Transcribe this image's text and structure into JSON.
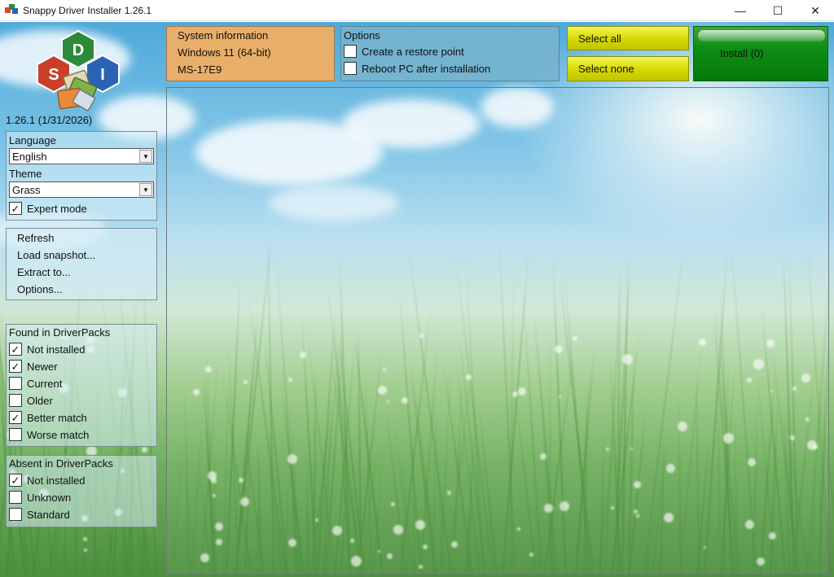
{
  "window": {
    "title": "Snappy Driver Installer 1.26.1",
    "minimize_glyph": "—",
    "maximize_glyph": "☐",
    "close_glyph": "✕"
  },
  "logo": {
    "letters": [
      "D",
      "S",
      "I"
    ]
  },
  "version": "1.26.1 (1/31/2026)",
  "settings": {
    "language_label": "Language",
    "language_value": "English",
    "theme_label": "Theme",
    "theme_value": "Grass",
    "expert_mode_label": "Expert mode",
    "expert_mode_checked": "✓"
  },
  "menu": {
    "refresh": "Refresh",
    "load_snapshot": "Load snapshot...",
    "extract_to": "Extract to...",
    "options": "Options..."
  },
  "found": {
    "title": "Found in DriverPacks",
    "items": [
      {
        "label": "Not installed",
        "mark": "✓"
      },
      {
        "label": "Newer",
        "mark": "✓"
      },
      {
        "label": "Current",
        "mark": ""
      },
      {
        "label": "Older",
        "mark": ""
      },
      {
        "label": "Better match",
        "mark": "✓"
      },
      {
        "label": "Worse match",
        "mark": ""
      }
    ]
  },
  "absent": {
    "title": "Absent in DriverPacks",
    "items": [
      {
        "label": "Not installed",
        "mark": "✓"
      },
      {
        "label": "Unknown",
        "mark": ""
      },
      {
        "label": "Standard",
        "mark": ""
      }
    ]
  },
  "system_info": {
    "title": "System information",
    "os": "Windows 11 (64-bit)",
    "model": "MS-17E9"
  },
  "options": {
    "title": "Options",
    "restore_point_label": "Create a restore point",
    "restore_point_mark": "",
    "reboot_label": "Reboot PC after installation",
    "reboot_mark": ""
  },
  "buttons": {
    "select_all": "Select all",
    "select_none": "Select none",
    "install": "Install (0)"
  },
  "colors": {
    "sysinfo_bg": "#e8ae6a",
    "yellow_button": "#d5d800",
    "install_green": "#0f8d14"
  }
}
